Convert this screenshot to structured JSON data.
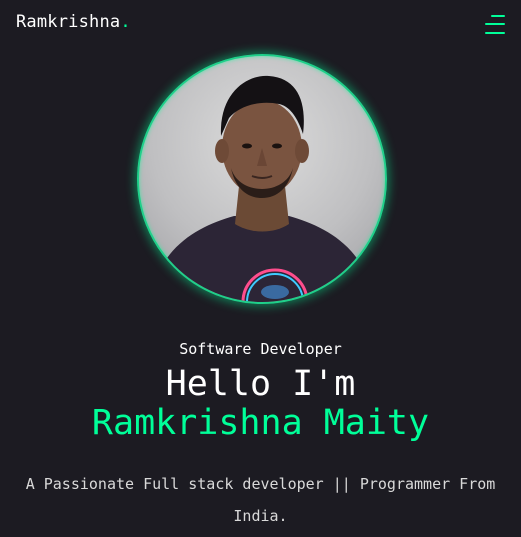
{
  "header": {
    "logo_text": "Ramkrishna",
    "logo_dot": ".",
    "menu_icon": "hamburger-menu-icon"
  },
  "hero": {
    "role": "Software Developer",
    "greeting": "Hello I'm",
    "name": "Ramkrishna Maity",
    "description": "A Passionate Full stack developer || Programmer From India."
  },
  "colors": {
    "background": "#1c1b22",
    "accent": "#00ff99",
    "text": "#ffffff"
  }
}
